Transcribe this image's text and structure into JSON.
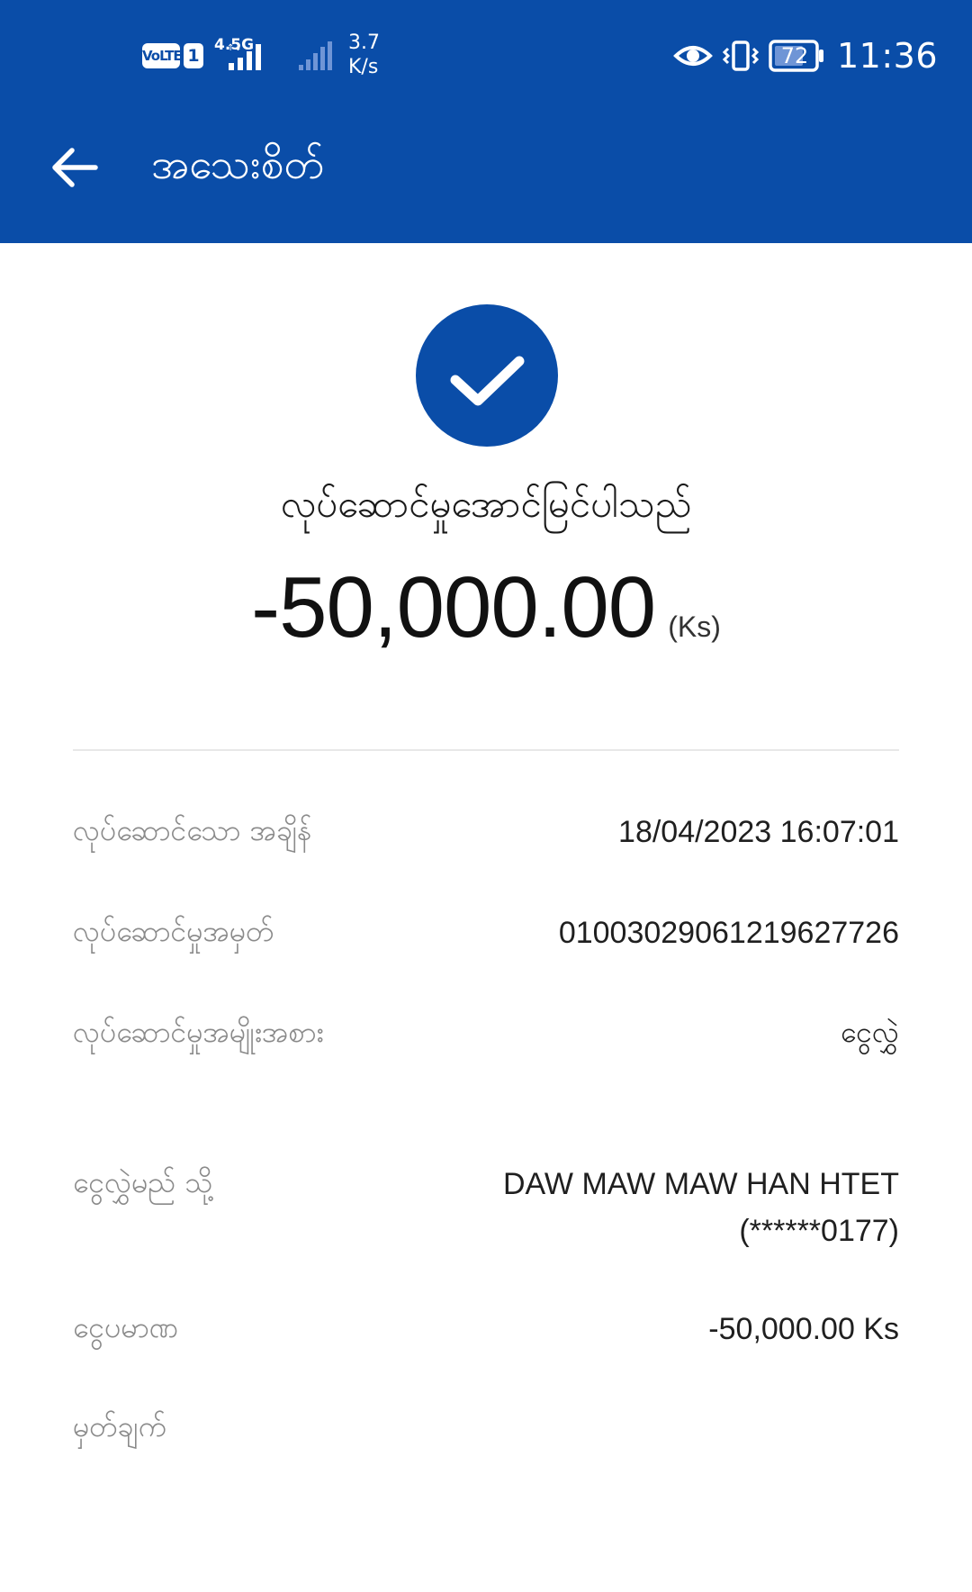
{
  "status_bar": {
    "volte": "VoLTE",
    "sim": "1",
    "network_type": "4.5G",
    "speed_value": "3.7",
    "speed_unit": "K/s",
    "battery": "72",
    "time": "11:36"
  },
  "header": {
    "title": "အသေးစိတ်",
    "background_color": "#0a4da8"
  },
  "icons": {
    "back": "arrow-left-icon",
    "success": "check-circle-icon",
    "eye": "eye-icon",
    "vibrate": "vibrate-icon",
    "battery": "battery-icon",
    "signal": "signal-icon"
  },
  "result": {
    "status_text": "လုပ်ဆောင်မှုအောင်မြင်ပါသည်",
    "amount": "-50,000.00",
    "currency": "(Ks)"
  },
  "details": [
    {
      "label": "လုပ်ဆောင်သော အချိန်",
      "value": "18/04/2023 16:07:01"
    },
    {
      "label": "လုပ်ဆောင်မှုအမှတ်",
      "value": "01003029061219627726"
    },
    {
      "label": "လုပ်ဆောင်မှုအမျိုးအစား",
      "value": "ငွေလွှဲ"
    },
    {
      "label": "ငွေလွှဲမည် သို့",
      "value": "DAW MAW MAW HAN HTET",
      "value2": "(******0177)"
    },
    {
      "label": "ငွေပမာဏ",
      "value": "-50,000.00 Ks"
    },
    {
      "label": "မှတ်ချက်",
      "value": ""
    }
  ]
}
